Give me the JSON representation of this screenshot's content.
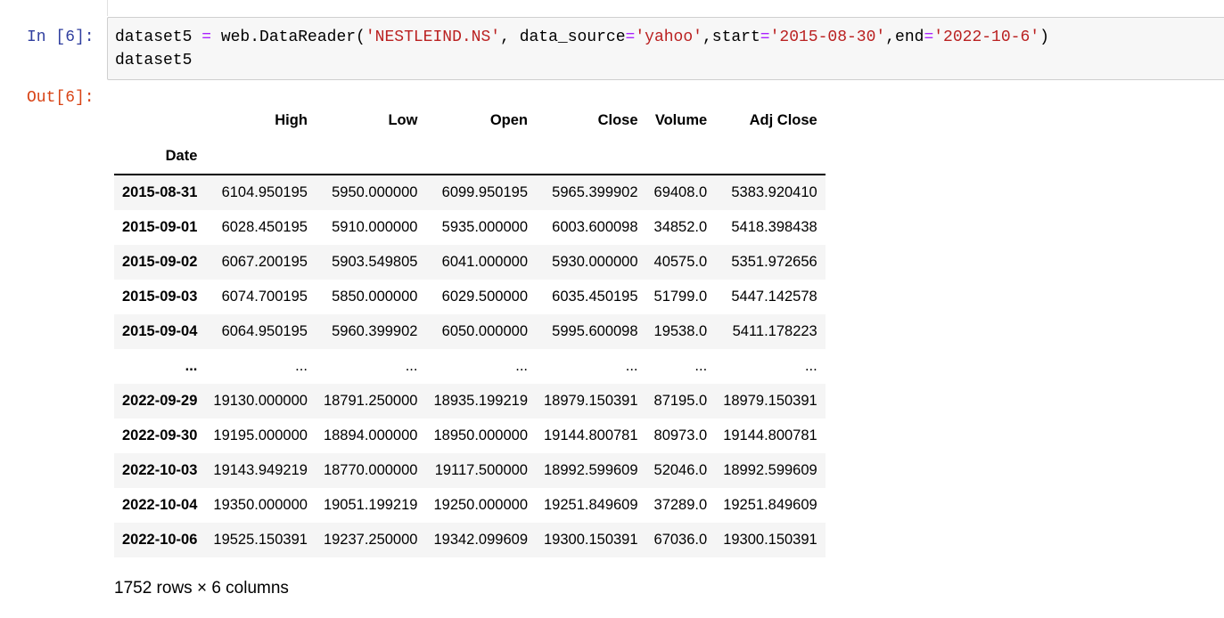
{
  "input_cell": {
    "prompt": "In [6]:",
    "code_line1": {
      "t1": "dataset5 ",
      "t2": "=",
      "t3": " web.DataReader(",
      "t4": "'NESTLEIND.NS'",
      "t5": ", data_source",
      "t6": "=",
      "t7": "'yahoo'",
      "t8": ",start",
      "t9": "=",
      "t10": "'2015-08-30'",
      "t11": ",end",
      "t12": "=",
      "t13": "'2022-10-6'",
      "t14": ")"
    },
    "code_line2": "dataset5"
  },
  "output_cell": {
    "prompt": "Out[6]:",
    "dataframe": {
      "columns": [
        "High",
        "Low",
        "Open",
        "Close",
        "Volume",
        "Adj Close"
      ],
      "index_name": "Date",
      "rows": [
        {
          "date": "2015-08-31",
          "values": [
            "6104.950195",
            "5950.000000",
            "6099.950195",
            "5965.399902",
            "69408.0",
            "5383.920410"
          ]
        },
        {
          "date": "2015-09-01",
          "values": [
            "6028.450195",
            "5910.000000",
            "5935.000000",
            "6003.600098",
            "34852.0",
            "5418.398438"
          ]
        },
        {
          "date": "2015-09-02",
          "values": [
            "6067.200195",
            "5903.549805",
            "6041.000000",
            "5930.000000",
            "40575.0",
            "5351.972656"
          ]
        },
        {
          "date": "2015-09-03",
          "values": [
            "6074.700195",
            "5850.000000",
            "6029.500000",
            "6035.450195",
            "51799.0",
            "5447.142578"
          ]
        },
        {
          "date": "2015-09-04",
          "values": [
            "6064.950195",
            "5960.399902",
            "6050.000000",
            "5995.600098",
            "19538.0",
            "5411.178223"
          ]
        },
        {
          "date": "...",
          "values": [
            "...",
            "...",
            "...",
            "...",
            "...",
            "..."
          ]
        },
        {
          "date": "2022-09-29",
          "values": [
            "19130.000000",
            "18791.250000",
            "18935.199219",
            "18979.150391",
            "87195.0",
            "18979.150391"
          ]
        },
        {
          "date": "2022-09-30",
          "values": [
            "19195.000000",
            "18894.000000",
            "18950.000000",
            "19144.800781",
            "80973.0",
            "19144.800781"
          ]
        },
        {
          "date": "2022-10-03",
          "values": [
            "19143.949219",
            "18770.000000",
            "19117.500000",
            "18992.599609",
            "52046.0",
            "18992.599609"
          ]
        },
        {
          "date": "2022-10-04",
          "values": [
            "19350.000000",
            "19051.199219",
            "19250.000000",
            "19251.849609",
            "37289.0",
            "19251.849609"
          ]
        },
        {
          "date": "2022-10-06",
          "values": [
            "19525.150391",
            "19237.250000",
            "19342.099609",
            "19300.150391",
            "67036.0",
            "19300.150391"
          ]
        }
      ],
      "shape_text": "1752 rows × 6 columns"
    }
  },
  "colors": {
    "in_prompt": "#303f9f",
    "out_prompt": "#d84315",
    "string_token": "#ba2121",
    "operator_token": "#aa22ff",
    "cell_background": "#f7f7f7",
    "odd_row": "#f5f5f5"
  }
}
